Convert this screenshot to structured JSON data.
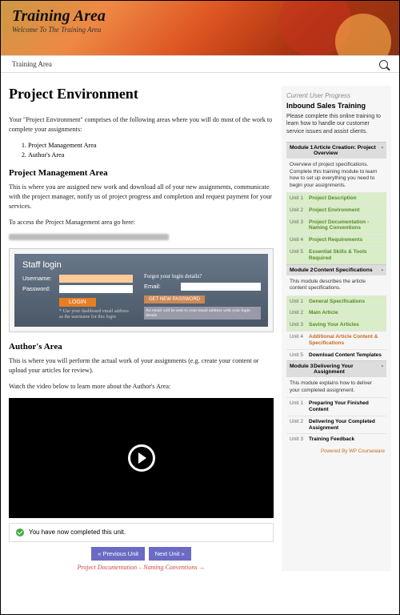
{
  "hero": {
    "title": "Training Area",
    "subtitle": "Welcome To The Training Area"
  },
  "nav": {
    "crumb": "Training Area"
  },
  "main": {
    "title": "Project Environment",
    "intro": "Your \"Project Environment\" comprises of the following areas where you will do most of the work to complete your assignments:",
    "list": [
      "Project Management Area",
      "Author's Area"
    ],
    "h_pma": "Project Management Area",
    "pma_p": "This is where you are assigned new work and download all of your new assignments, communicate with the project manager, notify us of project progress and completion and request payment for your services.",
    "pma_access": "To access the Project Management area go here:",
    "login": {
      "title": "Staff login",
      "user_lbl": "Username:",
      "pass_lbl": "Password:",
      "btn": "LOGIN",
      "note": "* Use your dashboard email address as the username for this login",
      "forgot": "Forgot your login details?",
      "email_lbl": "Email:",
      "btn2": "GET NEW PASSWORD",
      "note2": "An email will be sent to your email address with your login details"
    },
    "h_auth": "Author's Area",
    "auth_p": "This is where you will perform the actual work of your assignments (e.g. create your content or upload your articles for review).",
    "auth_watch": "Watch the video below to learn more about the Author's Area:",
    "complete": "You have now completed this unit.",
    "prev": "« Previous Unit",
    "next": "Next Unit »",
    "nextlink": "Project Documentation – Naming Conventions →"
  },
  "sidebar": {
    "prog": "Current User Progress",
    "title": "Inbound Sales Training",
    "intro": "Please complete this online training to learn how to handle our customer service issues and assist clients.",
    "mods": [
      {
        "num": "Module 1",
        "title": "Article Creation: Project Overview",
        "desc": "Overview of project specifications. Complete this training module to learn how to set up everything you need to begin your assignments.",
        "units": [
          {
            "u": "Unit 1",
            "t": "Project Description",
            "s": "done"
          },
          {
            "u": "Unit 2",
            "t": "Project Environment",
            "s": "done"
          },
          {
            "u": "Unit 3",
            "t": "Project Documentation - Naming Conventions",
            "s": "done"
          },
          {
            "u": "Unit 4",
            "t": "Project Requirements",
            "s": "done"
          },
          {
            "u": "Unit 5",
            "t": "Essential Skills & Tools Required",
            "s": "done"
          }
        ]
      },
      {
        "num": "Module 2",
        "title": "Content Specifications",
        "desc": "This module describes the article content specifications.",
        "units": [
          {
            "u": "Unit 1",
            "t": "General Specifications",
            "s": "done"
          },
          {
            "u": "Unit 2",
            "t": "Main Article",
            "s": "done"
          },
          {
            "u": "Unit 3",
            "t": "Saving Your Articles",
            "s": "done"
          },
          {
            "u": "Unit 4",
            "t": "Additional Article Content & Specifications",
            "s": "cur"
          },
          {
            "u": "Unit 5",
            "t": "Download Content Templates",
            "s": ""
          }
        ]
      },
      {
        "num": "Module 3",
        "title": "Delivering Your Assignment",
        "desc": "This module explains how to deliver your completed assignment.",
        "units": [
          {
            "u": "Unit 1",
            "t": "Preparing Your Finished Content",
            "s": ""
          },
          {
            "u": "Unit 2",
            "t": "Delivering Your Completed Assignment",
            "s": ""
          },
          {
            "u": "Unit 3",
            "t": "Training Feedback",
            "s": ""
          }
        ]
      }
    ],
    "powered": "Powered By ",
    "brand": "WP Courseware"
  }
}
